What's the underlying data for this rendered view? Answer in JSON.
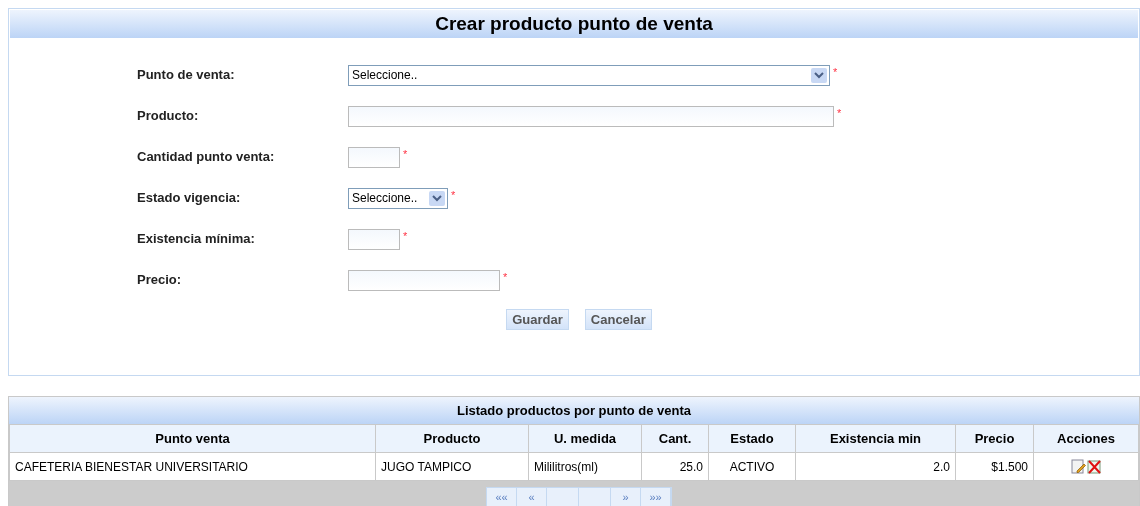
{
  "form": {
    "title": "Crear producto punto de venta",
    "fields": [
      {
        "kind": "select",
        "label": "Punto de venta:",
        "value": "Seleccione..",
        "required_mark": "*"
      },
      {
        "kind": "text",
        "label": "Producto:",
        "required_mark": "*"
      },
      {
        "kind": "text",
        "label": "Cantidad punto venta:",
        "required_mark": "*"
      },
      {
        "kind": "select",
        "label": "Estado vigencia:",
        "value": "Seleccione..",
        "required_mark": "*"
      },
      {
        "kind": "text",
        "label": "Existencia mínima:",
        "required_mark": "*"
      },
      {
        "kind": "text",
        "label": "Precio:",
        "required_mark": "*"
      }
    ],
    "buttons": [
      "Guardar",
      "Cancelar"
    ]
  },
  "table": {
    "title": "Listado productos por punto de venta",
    "columns": [
      "Punto venta",
      "Producto",
      "U. medida",
      "Cant.",
      "Estado",
      "Existencia min",
      "Precio",
      "Acciones"
    ],
    "rows": [
      [
        "CAFETERIA BIENESTAR UNIVERSITARIO",
        "JUGO TAMPICO",
        "Mililitros(ml)",
        "25.0",
        "ACTIVO",
        "2.0",
        "$1.500"
      ]
    ],
    "paginator": [
      "««",
      "«",
      "»",
      "»»"
    ]
  }
}
